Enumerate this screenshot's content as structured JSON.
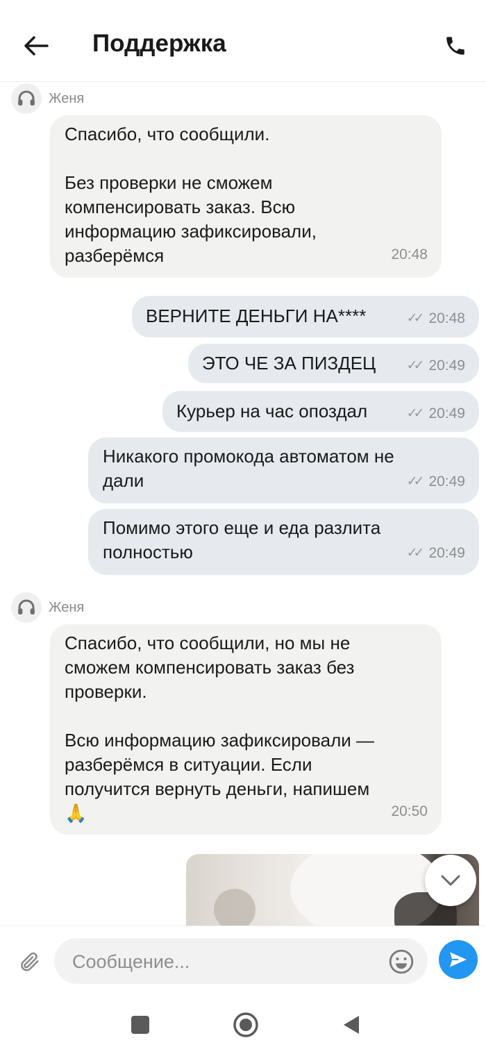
{
  "header": {
    "title": "Поддержка",
    "back_icon": "arrow-left-icon",
    "call_icon": "phone-icon"
  },
  "messages": [
    {
      "type": "sender",
      "name": "Женя"
    },
    {
      "type": "in",
      "text": "Спасибо, что сообщили.\n\nБез проверки не сможем\nкомпенсировать заказ. Всю\nинформацию зафиксировали,\nразберёмся",
      "time": "20:48"
    },
    {
      "type": "out",
      "text": "ВЕРНИТЕ ДЕНЬГИ НА****",
      "time": "20:48"
    },
    {
      "type": "out",
      "text": "ЭТО ЧЕ ЗА ПИЗДЕЦ",
      "time": "20:49"
    },
    {
      "type": "out",
      "text": "Курьер на час опоздал",
      "time": "20:49"
    },
    {
      "type": "out",
      "text": "Никакого промокода автоматом не\nдали",
      "time": "20:49"
    },
    {
      "type": "out",
      "text": "Помимо этого еще и еда разлита\nполностью",
      "time": "20:49"
    },
    {
      "type": "sender",
      "name": "Женя"
    },
    {
      "type": "in",
      "text": "Спасибо, что сообщили, но мы не\nсможем компенсировать заказ без\nпроверки.\n\nВсю информацию зафиксировали —\nразберёмся в ситуации. Если\nполучится вернуть деньги, напишем\n🙏",
      "time": "20:50"
    }
  ],
  "composer": {
    "placeholder": "Сообщение...",
    "value": ""
  },
  "colors": {
    "accent": "#2196f3",
    "bubble_in": "#f2f2f0",
    "bubble_out": "#e6eaee",
    "muted_text": "#8e8e8e"
  }
}
